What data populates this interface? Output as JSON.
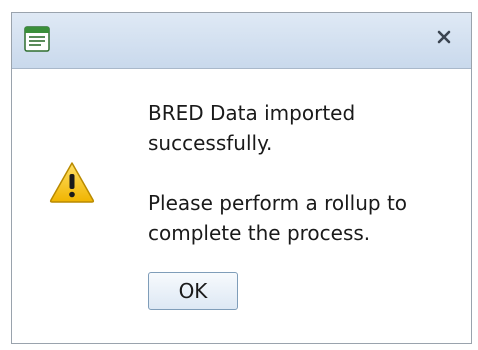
{
  "dialog": {
    "close_glyph": "x",
    "message_line1": "BRED Data imported successfully.",
    "message_line2": "Please perform a rollup to complete the process.",
    "ok_label": "OK"
  },
  "icons": {
    "app": "window-app-icon",
    "close": "close-icon",
    "warning": "warning-icon"
  },
  "colors": {
    "titlebar_top": "#dfe9f5",
    "titlebar_bottom": "#c9d9ec",
    "app_icon_green": "#3a8f3a",
    "warning_yellow": "#f5c518",
    "button_border": "#7f9db9"
  }
}
